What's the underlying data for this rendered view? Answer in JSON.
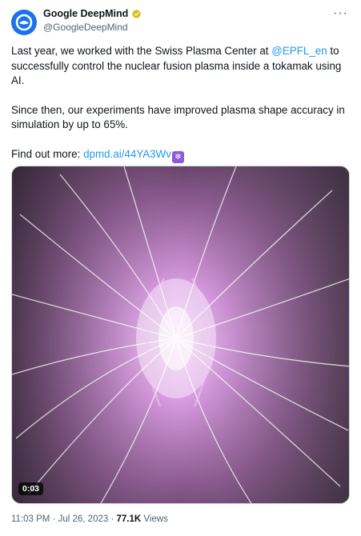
{
  "author": {
    "display_name": "Google DeepMind",
    "handle": "@GoogleDeepMind",
    "avatar_icon": "deepmind-logo-icon",
    "verified_icon": "verified-gold-badge-icon"
  },
  "more_label": "···",
  "body": {
    "p1_before": "Last year, we worked with the Swiss Plasma Center at ",
    "p1_mention": "@EPFL_en",
    "p1_after": " to successfully control the nuclear fusion plasma inside a tokamak using AI.",
    "p2": "Since then, our experiments have improved plasma shape accuracy in simulation by up to 65%.",
    "p3_before": "Find out more: ",
    "p3_link": "dpmd.ai/44YA3Wv",
    "p3_emoji": "❄"
  },
  "media": {
    "duration": "0:03",
    "description_colors": {
      "plasma": "#c98bd6",
      "dark": "#2b1f2e"
    }
  },
  "meta": {
    "time": "11:03 PM",
    "sep1": " · ",
    "date": "Jul 26, 2023",
    "sep2": " · ",
    "views_count": "77.1K",
    "views_label": " Views"
  },
  "colors": {
    "link": "#1d9bf0",
    "secondary": "#536471",
    "avatar_bg": "#1a73e8",
    "verified": "#e2b719"
  }
}
